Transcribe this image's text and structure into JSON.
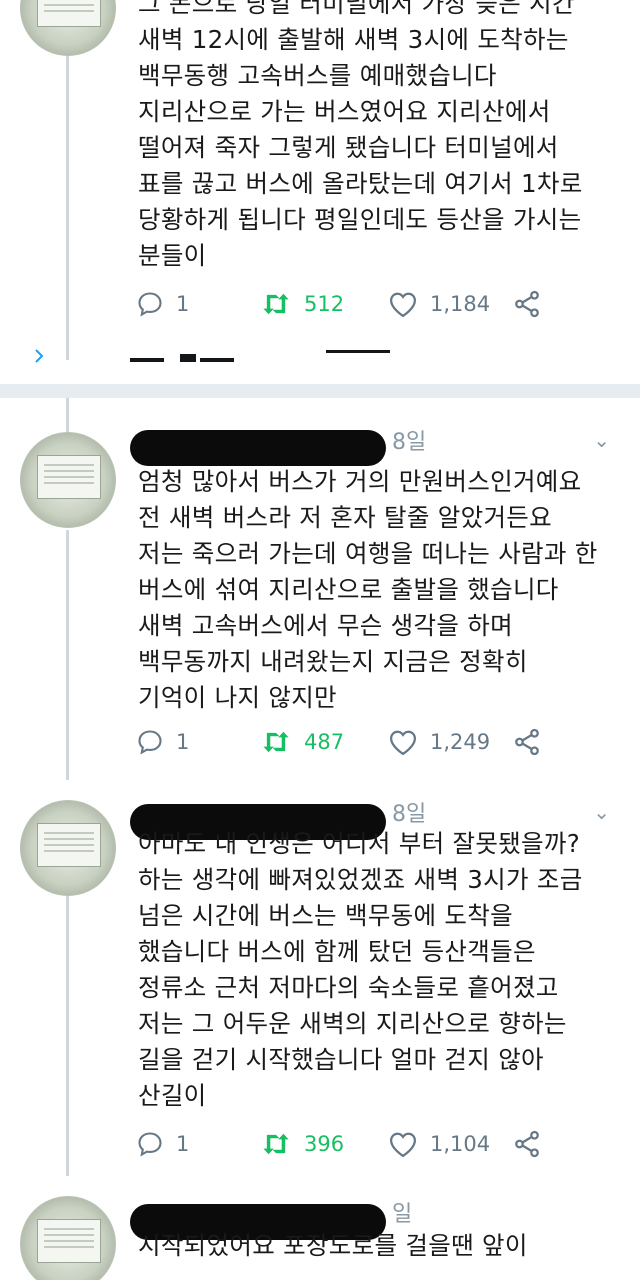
{
  "colors": {
    "retweet_green": "#17bf63",
    "action_gray": "#667785",
    "meta_gray": "#8899a6",
    "divider": "#e6ecf0"
  },
  "icons": {
    "reply": "reply-icon",
    "retweet": "retweet-icon",
    "like": "heart-icon",
    "share": "share-icon",
    "menu": "chevron-down-icon"
  },
  "tweets": [
    {
      "date": "",
      "lines": [
        "그 돈으로 당일 터미널에서 가장 늦은 시간",
        "새벽 12시에 출발해 새벽 3시에 도착하는",
        "백무동행 고속버스를 예매했습니다",
        "지리산으로 가는 버스였어요 지리산에서",
        "떨어져 죽자 그렇게 됐습니다 터미널에서",
        "표를 끊고 버스에 올라탔는데 여기서 1차로",
        "당황하게 됩니다 평일인데도 등산을 가시는",
        "분들이"
      ],
      "replies": "1",
      "retweets": "512",
      "likes": "1,184"
    },
    {
      "date": "8일",
      "lines": [
        "엄청 많아서 버스가 거의 만원버스인거예요",
        "전 새벽 버스라 저 혼자 탈줄 알았거든요",
        "저는 죽으러 가는데 여행을 떠나는 사람과 한",
        "버스에 섞여 지리산으로 출발을 했습니다",
        "새벽 고속버스에서 무슨 생각을 하며",
        "백무동까지 내려왔는지 지금은 정확히",
        "기억이 나지 않지만"
      ],
      "replies": "1",
      "retweets": "487",
      "likes": "1,249"
    },
    {
      "date": "8일",
      "lines": [
        "아마도 내 인생은 어디서 부터 잘못됐을까?",
        "하는 생각에 빠져있었겠죠 새벽 3시가 조금",
        "넘은 시간에 버스는 백무동에 도착을",
        "했습니다 버스에 함께 탔던 등산객들은",
        "정류소 근처 저마다의 숙소들로 흩어졌고",
        "저는 그 어두운 새벽의 지리산으로 향하는",
        "길을 걷기 시작했습니다 얼마 걷지 않아",
        "산길이"
      ],
      "replies": "1",
      "retweets": "396",
      "likes": "1,104"
    },
    {
      "date": "일",
      "lines": [
        "시작되었어요 포장도로를 걸을땐 앞이"
      ]
    }
  ]
}
